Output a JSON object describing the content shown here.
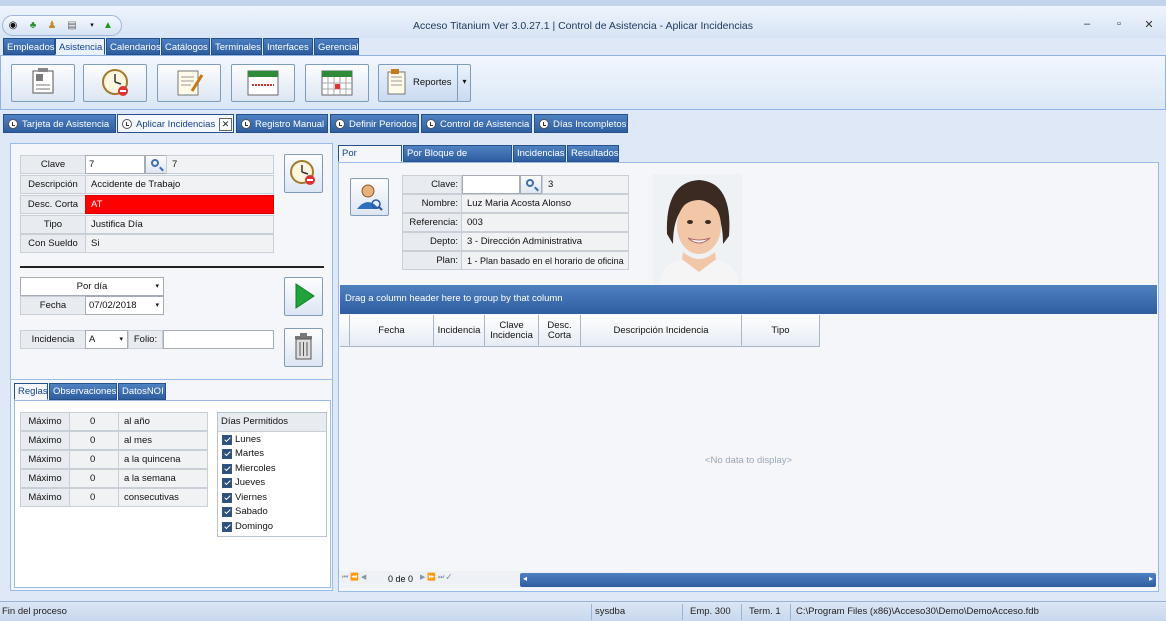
{
  "window": {
    "title": "Acceso Titanium  Ver 3.0.27.1 | Control de Asistencia - Aplicar Incidencias"
  },
  "ribbon_tabs": [
    "Empleados",
    "Asistencia",
    "Calendarios",
    "Catálogos",
    "Terminales",
    "Interfaces",
    "Gerencial"
  ],
  "ribbon": {
    "reportes_label": "Reportes"
  },
  "doc_tabs": [
    "Tarjeta de Asistencia",
    "Aplicar Incidencias",
    "Registro Manual",
    "Definir Periodos",
    "Control de Asistencia",
    "Días Incompletos"
  ],
  "left": {
    "clave_label": "Clave",
    "clave_value": "7",
    "clave_result": "7",
    "descripcion_label": "Descripción",
    "descripcion_value": "Accidente de Trabajo",
    "desc_corta_label": "Desc. Corta",
    "desc_corta_value": "AT",
    "tipo_label": "Tipo",
    "tipo_value": "Justifica Día",
    "con_sueldo_label": "Con Sueldo",
    "con_sueldo_value": "Si",
    "modo_value": "Por día",
    "fecha_label": "Fecha",
    "fecha_value": "07/02/2018",
    "incidencia_label": "Incidencia",
    "incidencia_value": "A",
    "folio_label": "Folio:",
    "folio_value": ""
  },
  "sub_tabs": [
    "Reglas",
    "Observaciones",
    "DatosNOI"
  ],
  "rules": {
    "rows": [
      {
        "label": "Máximo",
        "value": "0",
        "unit": "al año"
      },
      {
        "label": "Máximo",
        "value": "0",
        "unit": "al mes"
      },
      {
        "label": "Máximo",
        "value": "0",
        "unit": "a la quincena"
      },
      {
        "label": "Máximo",
        "value": "0",
        "unit": "a la semana"
      },
      {
        "label": "Máximo",
        "value": "0",
        "unit": "consecutivas"
      }
    ],
    "dias_header": "Días Permitidos",
    "dias": [
      "Lunes",
      "Martes",
      "Miercoles",
      "Jueves",
      "Viernes",
      "Sabado",
      "Domingo"
    ]
  },
  "right_tabs": [
    "Por Empleado",
    "Por Bloque de Empleados",
    "Incidencias",
    "Resultados"
  ],
  "employee": {
    "clave_label": "Clave:",
    "clave_value": "",
    "clave_result": "3",
    "nombre_label": "Nombre:",
    "nombre_value": "Luz Maria Acosta Alonso",
    "referencia_label": "Referencia:",
    "referencia_value": "003",
    "depto_label": "Depto:",
    "depto_value": "3 - Dirección Administrativa",
    "plan_label": "Plan:",
    "plan_value": "1 - Plan basado en el horario de oficina"
  },
  "grid": {
    "group_hint": "Drag a column header here to group by that column",
    "columns": [
      "Fecha",
      "Incidencia",
      "Clave Incidencia",
      "Desc. Corta",
      "Descripción Incidencia",
      "Tipo"
    ],
    "empty_text": "<No data to display>",
    "pager_text": "0 de 0"
  },
  "status": {
    "message": "Fin del proceso",
    "user": "sysdba",
    "emp": "Emp. 300",
    "term": "Term. 1",
    "path": "C:\\Program Files (x86)\\Acceso30\\Demo\\DemoAcceso.fdb"
  },
  "colors": {
    "accent": "#2d5d9f",
    "highlight_red": "#ff0000",
    "header_blue": "#3a6db0"
  }
}
